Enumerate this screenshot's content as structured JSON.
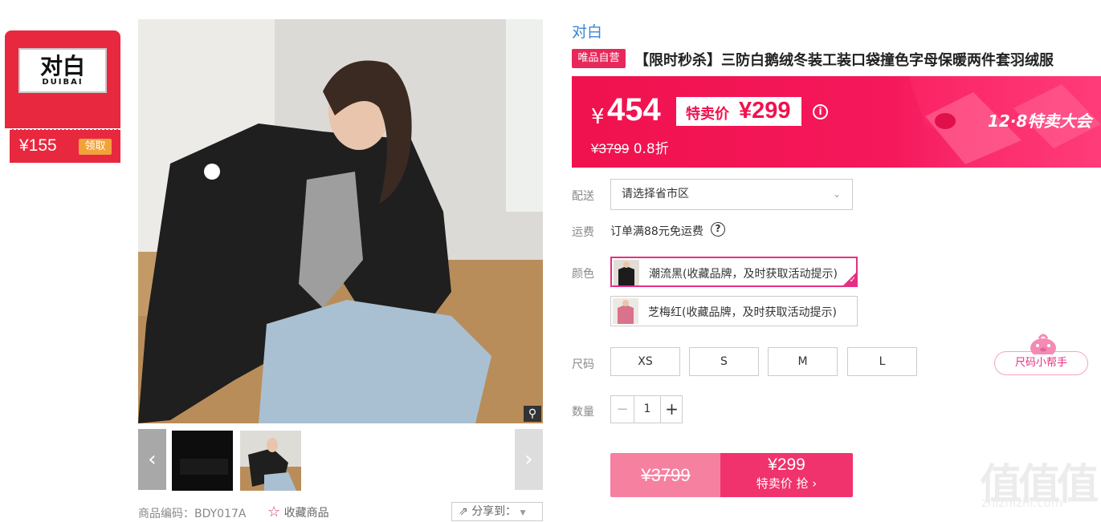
{
  "coupon": {
    "brand_cn": "对白",
    "brand_en": "DUIBAI",
    "amount": "¥155",
    "claim_label": "领取"
  },
  "gallery": {
    "zoom_icon": "magnifier-icon",
    "prev_icon": "chevron-left-icon",
    "next_icon": "chevron-right-icon"
  },
  "product_meta": {
    "code": "商品编码：BDY017A",
    "favorite": "收藏商品",
    "share": "分享到："
  },
  "product": {
    "brand": "对白",
    "badge": "唯品自营",
    "title": "【限时秒杀】三防白鹅绒冬装工装口袋撞色字母保暖两件套羽绒服"
  },
  "price": {
    "currency": "¥",
    "current": "454",
    "special_label": "特卖价",
    "special_price": "¥299",
    "original": "¥3799",
    "discount": "0.8折",
    "event": "12·8特卖大会",
    "colors": {
      "bar": "#f0124e",
      "accent": "#e72e82"
    }
  },
  "delivery": {
    "label": "配送",
    "placeholder": "请选择省市区"
  },
  "shipping": {
    "label": "运费",
    "text": "订单满88元免运费"
  },
  "colors": {
    "label": "颜色",
    "options": [
      {
        "name": "潮流黑(收藏品牌，及时获取活动提示)",
        "selected": true,
        "swatch": "#1c1c1c"
      },
      {
        "name": "芝梅红(收藏品牌，及时获取活动提示)",
        "selected": false,
        "swatch": "#d9728a"
      }
    ]
  },
  "sizes": {
    "label": "尺码",
    "options": [
      "XS",
      "S",
      "M",
      "L"
    ],
    "helper": "尺码小帮手"
  },
  "quantity": {
    "label": "数量",
    "value": "1",
    "minus": "−",
    "plus": "+"
  },
  "buy": {
    "original": "¥3799",
    "price": "¥299",
    "action": "特卖价 抢 ›"
  },
  "watermark": {
    "glyphs": "值值值",
    "domain": "zhizhizhi.com"
  }
}
